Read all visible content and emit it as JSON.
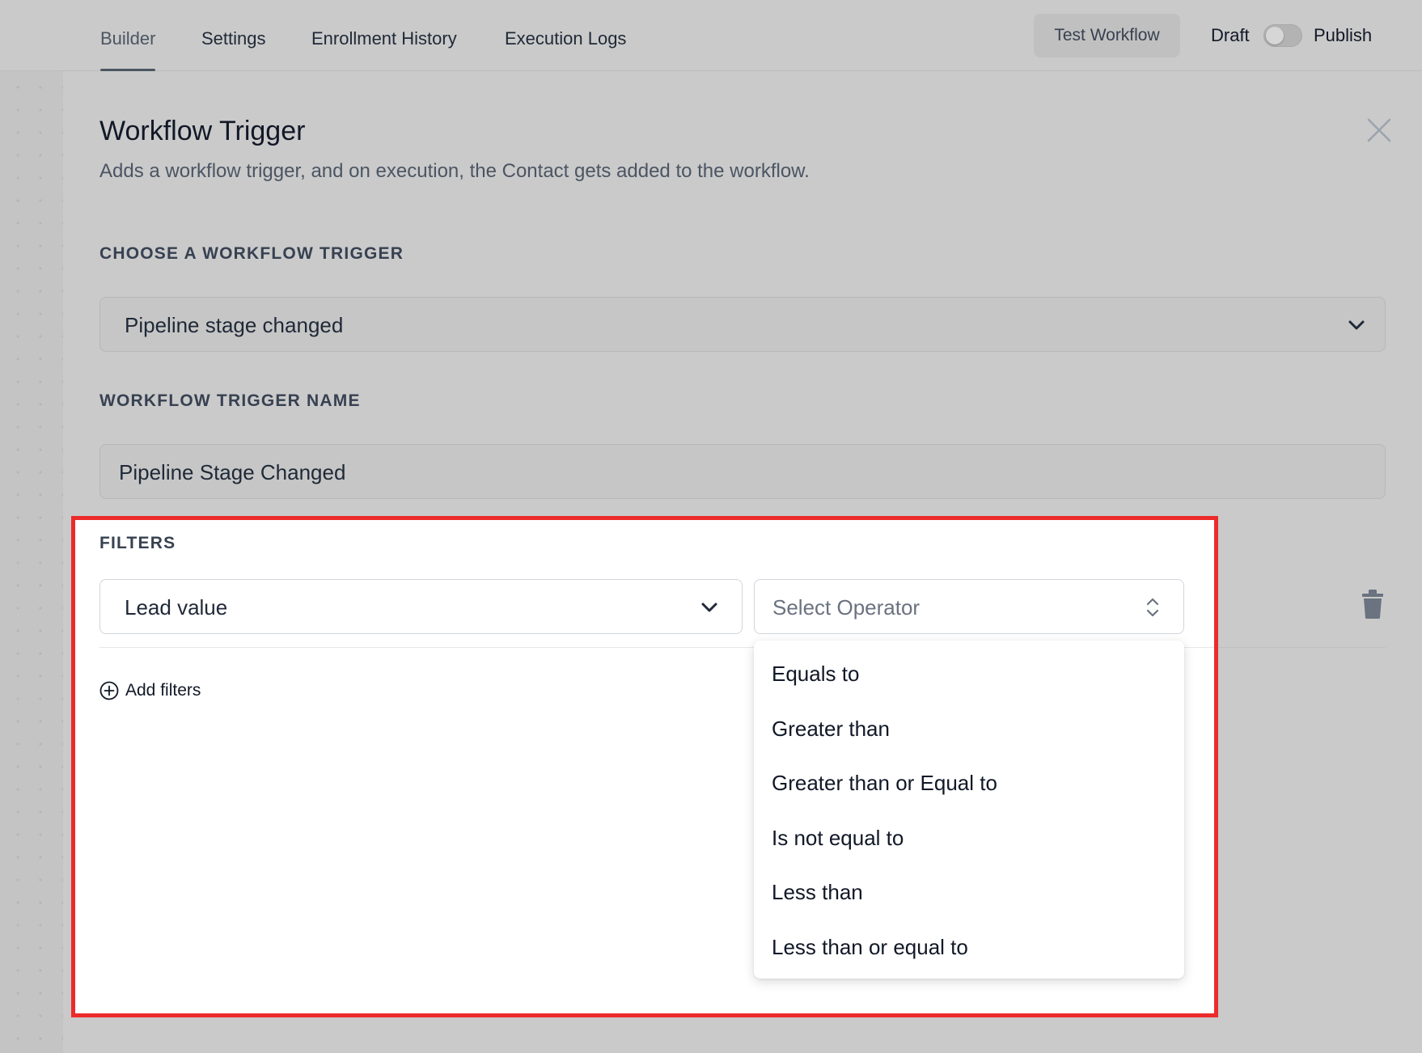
{
  "nav": {
    "tabs": [
      {
        "label": "Builder",
        "active": true
      },
      {
        "label": "Settings",
        "active": false
      },
      {
        "label": "Enrollment History",
        "active": false
      },
      {
        "label": "Execution Logs",
        "active": false
      }
    ],
    "test_button": "Test Workflow",
    "draft_label": "Draft",
    "publish_label": "Publish",
    "publish_toggle_on": false
  },
  "panel": {
    "title": "Workflow Trigger",
    "subtitle": "Adds a workflow trigger, and on execution, the Contact gets added to the workflow.",
    "trigger_section_label": "CHOOSE A WORKFLOW TRIGGER",
    "trigger_value": "Pipeline stage changed",
    "name_section_label": "WORKFLOW TRIGGER NAME",
    "name_value": "Pipeline Stage Changed"
  },
  "filters": {
    "section_label": "FILTERS",
    "field_value": "Lead value",
    "operator_placeholder": "Select Operator",
    "add_filters_label": "Add filters",
    "operator_options": [
      "Equals to",
      "Greater than",
      "Greater than or Equal to",
      "Is not equal to",
      "Less than",
      "Less than or equal to"
    ]
  },
  "colors": {
    "highlight_border": "#ec2b2b",
    "overlay_bg": "#cacaca"
  }
}
